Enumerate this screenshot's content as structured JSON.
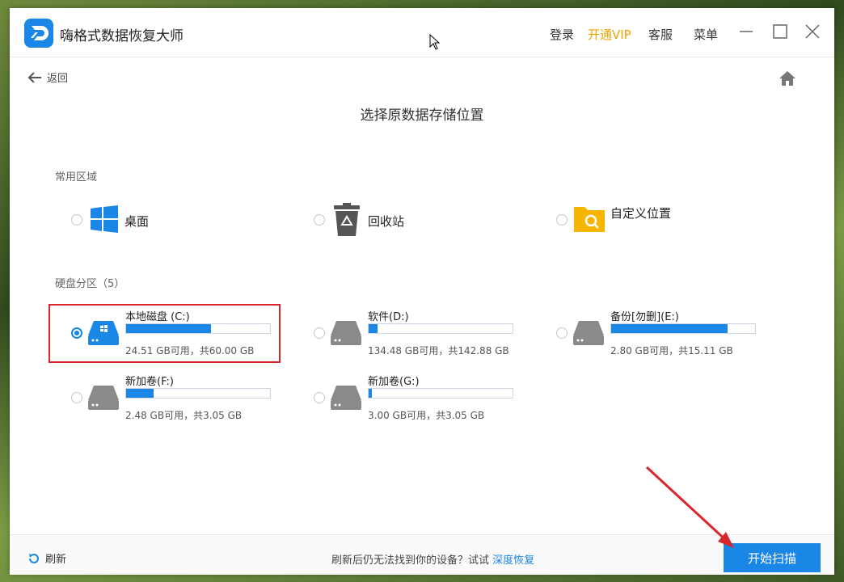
{
  "app": {
    "title": "嗨格式数据恢复大师"
  },
  "titlebar": {
    "login": "登录",
    "vip": "开通VIP",
    "service": "客服",
    "menu": "菜单"
  },
  "nav": {
    "back": "返回"
  },
  "page": {
    "title": "选择原数据存储位置"
  },
  "common": {
    "label": "常用区域",
    "items": [
      {
        "label": "桌面",
        "icon": "windows-icon"
      },
      {
        "label": "回收站",
        "icon": "recycle-bin-icon"
      },
      {
        "label": "自定义位置",
        "icon": "folder-search-icon"
      }
    ]
  },
  "disks": {
    "label": "硬盘分区（5）",
    "items": [
      {
        "name": "本地磁盘 (C:)",
        "info": "24.51 GB可用，共60.00 GB",
        "used_fraction": 0.59,
        "selected": true,
        "system": true
      },
      {
        "name": "软件(D:)",
        "info": "134.48 GB可用，共142.88 GB",
        "used_fraction": 0.06,
        "selected": false,
        "system": false
      },
      {
        "name": "备份[勿删](E:)",
        "info": "2.80 GB可用，共15.11 GB",
        "used_fraction": 0.81,
        "selected": false,
        "system": false
      },
      {
        "name": "新加卷(F:)",
        "info": "2.48 GB可用，共3.05 GB",
        "used_fraction": 0.19,
        "selected": false,
        "system": false
      },
      {
        "name": "新加卷(G:)",
        "info": "3.00 GB可用，共3.05 GB",
        "used_fraction": 0.02,
        "selected": false,
        "system": false
      }
    ]
  },
  "footer": {
    "refresh": "刷新",
    "hint": "刷新后仍无法找到你的设备？试试",
    "deep": "深度恢复",
    "start": "开始扫描"
  },
  "colors": {
    "accent": "#1a86e6",
    "vip": "#f2a300",
    "highlight": "#d8262b"
  }
}
